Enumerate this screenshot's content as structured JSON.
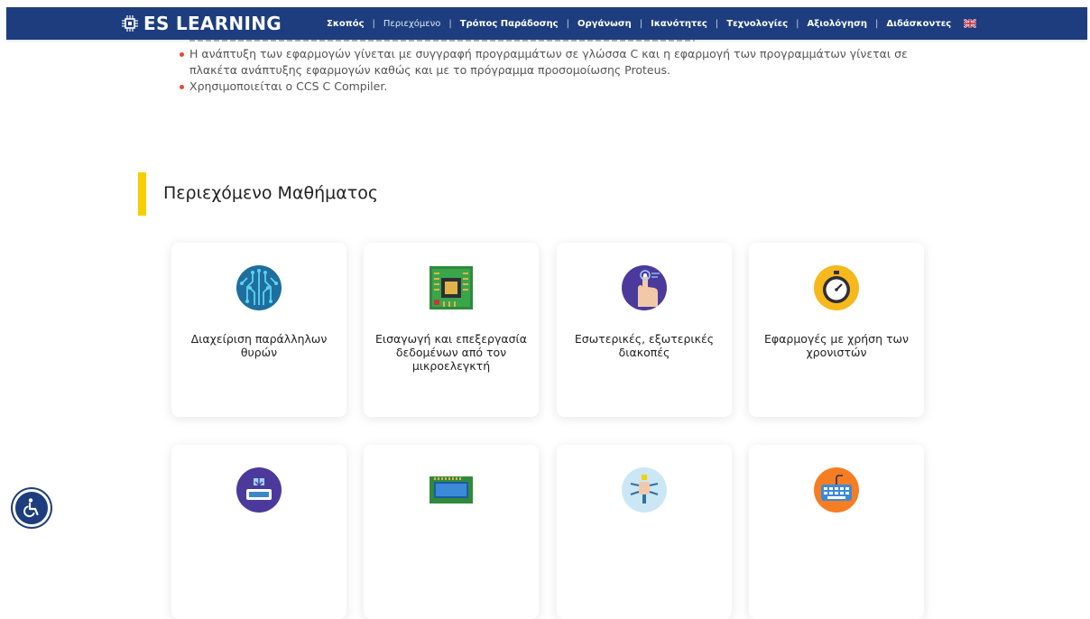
{
  "brand": {
    "name": "ES LEARNING"
  },
  "nav": {
    "items": [
      {
        "label": "Σκοπός",
        "style": "bold"
      },
      {
        "label": "Περιεχόμενο",
        "style": "light"
      },
      {
        "label": "Τρόπος Παράδοσης",
        "style": "bold"
      },
      {
        "label": "Οργάνωση",
        "style": "bold"
      },
      {
        "label": "Ικανότητες",
        "style": "bold"
      },
      {
        "label": "Τεχνολογίες",
        "style": "bold"
      },
      {
        "label": "Αξιολόγηση",
        "style": "bold"
      },
      {
        "label": "Διδάσκοντες",
        "style": "bold"
      }
    ],
    "separator": "|",
    "language_flag": "uk-flag-icon"
  },
  "bullets": [
    "Η ανάπτυξη των εφαρμογών γίνεται με συγγραφή προγραμμάτων σε γλώσσα C και η εφαρμογή των προγραμμάτων γίνεται σε πλακέτα ανάπτυξης εφαρμογών καθώς και με το πρόγραμμα προσομοίωσης Proteus.",
    "Χρησιμοποιείται ο CCS C Compiler."
  ],
  "section": {
    "title": "Περιεχόμενο Μαθήματος"
  },
  "cards": [
    {
      "label": "Διαχείριση παράλληλων θυρών",
      "icon": "circuit-icon"
    },
    {
      "label": "Εισαγωγή και επεξεργασία δεδομένων από τον μικροελεγκτή",
      "icon": "microchip-board-icon"
    },
    {
      "label": "Εσωτερικές, εξωτερικές διακοπές",
      "icon": "touch-hand-icon"
    },
    {
      "label": "Εφαρμογές με χρήση των χρονιστών",
      "icon": "stopwatch-icon"
    },
    {
      "label": "",
      "icon": "device-tray-icon"
    },
    {
      "label": "",
      "icon": "lcd-display-icon"
    },
    {
      "label": "",
      "icon": "robot-icon"
    },
    {
      "label": "",
      "icon": "keyboard-icon"
    }
  ],
  "colors": {
    "nav_bg": "#1d3d7e",
    "accent_bar": "#f4d000",
    "bullet": "#e8453c"
  },
  "accessibility": {
    "icon": "wheelchair-icon"
  }
}
